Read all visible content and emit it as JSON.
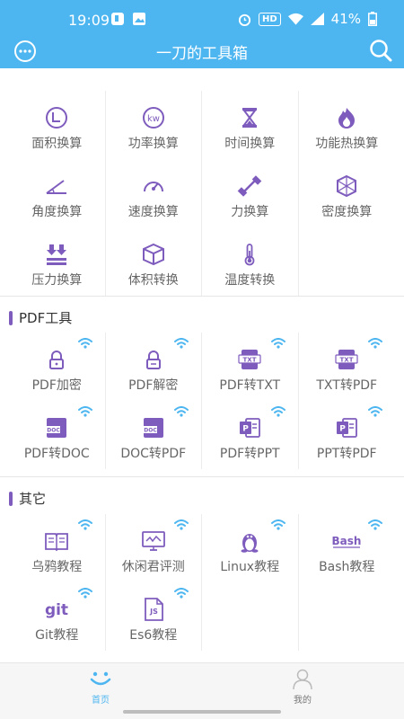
{
  "status_bar": {
    "time": "19:09",
    "battery": "41%",
    "hd": "HD"
  },
  "app_bar": {
    "title": "一刀的工具箱",
    "menu_icon": "more-circle-icon",
    "search_icon": "search-icon"
  },
  "colors": {
    "primary": "#4db6f0",
    "accent": "#7e5cbd",
    "wifi": "#4db6f0"
  },
  "converters": [
    {
      "label": "面积换算",
      "icon": "area-icon"
    },
    {
      "label": "功率换算",
      "icon": "kw-icon"
    },
    {
      "label": "时间换算",
      "icon": "hourglass-icon"
    },
    {
      "label": "功能热换算",
      "icon": "flame-icon"
    },
    {
      "label": "角度换算",
      "icon": "angle-icon"
    },
    {
      "label": "速度换算",
      "icon": "speedometer-icon"
    },
    {
      "label": "力换算",
      "icon": "dumbbell-icon"
    },
    {
      "label": "密度换算",
      "icon": "cube-density-icon"
    },
    {
      "label": "压力换算",
      "icon": "pressure-icon"
    },
    {
      "label": "体积转换",
      "icon": "box-icon"
    },
    {
      "label": "温度转换",
      "icon": "thermometer-icon"
    }
  ],
  "pdf_section": {
    "title": "PDF工具",
    "items": [
      {
        "label": "PDF加密",
        "icon": "lock-icon"
      },
      {
        "label": "PDF解密",
        "icon": "unlock-icon"
      },
      {
        "label": "PDF转TXT",
        "icon": "txt-file-icon"
      },
      {
        "label": "TXT转PDF",
        "icon": "txt-file-icon"
      },
      {
        "label": "PDF转DOC",
        "icon": "doc-file-icon"
      },
      {
        "label": "DOC转PDF",
        "icon": "doc-file-icon"
      },
      {
        "label": "PDF转PPT",
        "icon": "ppt-file-icon"
      },
      {
        "label": "PPT转PDF",
        "icon": "ppt-file-icon"
      }
    ]
  },
  "other_section": {
    "title": "其它",
    "items": [
      {
        "label": "乌鸦教程",
        "icon": "book-icon"
      },
      {
        "label": "休闲君评测",
        "icon": "monitor-icon"
      },
      {
        "label": "Linux教程",
        "icon": "linux-penguin-icon"
      },
      {
        "label": "Bash教程",
        "icon": "bash-logo-icon",
        "logo_text": "Bash"
      },
      {
        "label": "Git教程",
        "icon": "git-logo-icon",
        "logo_text": "git"
      },
      {
        "label": "Es6教程",
        "icon": "js-file-icon",
        "logo_text": "JS"
      }
    ]
  },
  "bottom_nav": [
    {
      "label": "首页",
      "icon": "smile-icon",
      "active": true
    },
    {
      "label": "我的",
      "icon": "user-icon",
      "active": false
    }
  ]
}
